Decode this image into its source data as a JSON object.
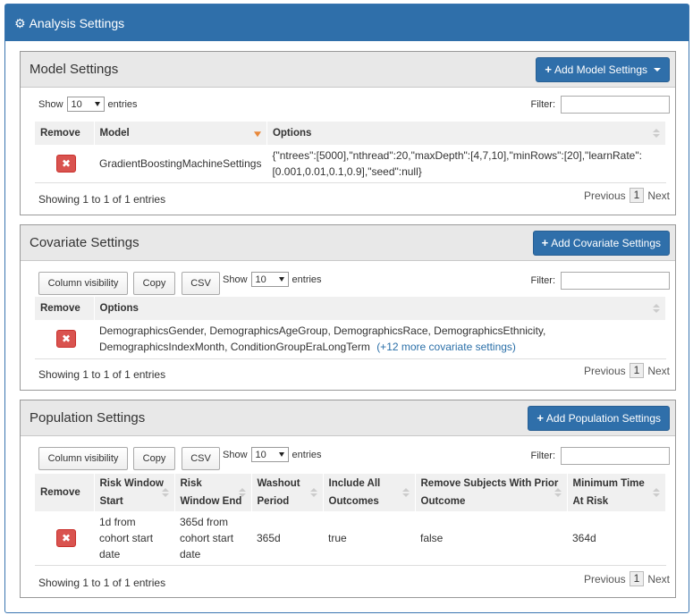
{
  "header": {
    "title": "Analysis Settings",
    "icon": "gears-icon"
  },
  "model_panel": {
    "title": "Model Settings",
    "add_button": "Add Model Settings",
    "show_label": "Show",
    "entries_label": "entries",
    "page_size": "10",
    "filter_label": "Filter:",
    "columns": [
      "Remove",
      "Model",
      "Options"
    ],
    "rows": [
      {
        "model": "GradientBoostingMachineSettings",
        "options_line1": "{\"ntrees\":[5000],\"nthread\":20,\"maxDepth\":[4,7,10],\"minRows\":[20],\"learnRate\":",
        "options_line2": "[0.001,0.01,0.1,0.9],\"seed\":null}"
      }
    ],
    "info": "Showing 1 to 1 of 1 entries",
    "prev": "Previous",
    "page": "1",
    "next": "Next"
  },
  "covariate_panel": {
    "title": "Covariate Settings",
    "add_button": "Add Covariate Settings",
    "column_visibility": "Column visibility",
    "copy": "Copy",
    "csv": "CSV",
    "show_label": "Show",
    "entries_label": "entries",
    "page_size": "10",
    "filter_label": "Filter:",
    "columns": [
      "Remove",
      "Options"
    ],
    "rows": [
      {
        "options_line1": "DemographicsGender, DemographicsAgeGroup, DemographicsRace, DemographicsEthnicity,",
        "options_line2": "DemographicsIndexMonth, ConditionGroupEraLongTerm",
        "more_link": "(+12 more covariate settings)"
      }
    ],
    "info": "Showing 1 to 1 of 1 entries",
    "prev": "Previous",
    "page": "1",
    "next": "Next"
  },
  "population_panel": {
    "title": "Population Settings",
    "add_button": "Add Population Settings",
    "column_visibility": "Column visibility",
    "copy": "Copy",
    "csv": "CSV",
    "show_label": "Show",
    "entries_label": "entries",
    "page_size": "10",
    "filter_label": "Filter:",
    "columns": [
      [
        "Remove"
      ],
      [
        "Risk Window",
        "Start"
      ],
      [
        "Risk",
        "Window End"
      ],
      [
        "Washout",
        "Period"
      ],
      [
        "Include All",
        "Outcomes"
      ],
      [
        "Remove Subjects With Prior",
        "Outcome"
      ],
      [
        "Minimum Time",
        "At Risk"
      ]
    ],
    "rows": [
      {
        "risk_start": [
          "1d from",
          "cohort start",
          "date"
        ],
        "risk_end": [
          "365d from",
          "cohort start",
          "date"
        ],
        "washout": "365d",
        "include_all": "true",
        "remove_prior": "false",
        "min_time": "364d"
      }
    ],
    "info": "Showing 1 to 1 of 1 entries",
    "prev": "Previous",
    "page": "1",
    "next": "Next"
  },
  "colors": {
    "primary": "#2f6faa",
    "danger": "#d9534f",
    "sort_active": "#e8883a",
    "link": "#2a6fa8"
  }
}
